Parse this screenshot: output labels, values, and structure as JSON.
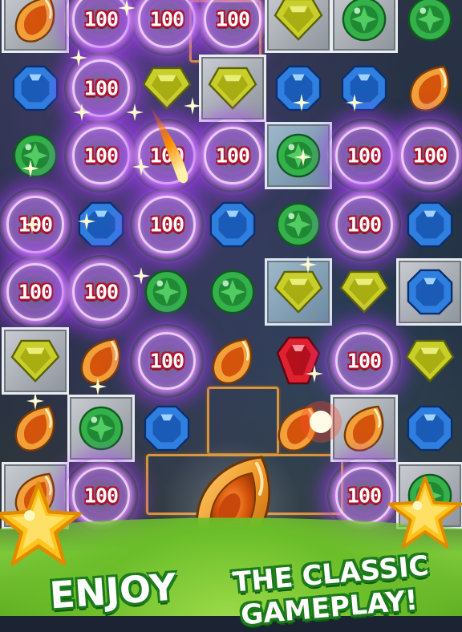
{
  "score_popup": "100",
  "banner": {
    "word1": "ENJOY",
    "word2": "THE CLASSIC",
    "word3": "GAMEPLAY!"
  },
  "board": {
    "rows": [
      [
        "amber-leaf-gem",
        "score-burst",
        "score-burst",
        "score-burst",
        "yellow-pentagon-gem",
        "green-round-gem",
        "green-round-gem"
      ],
      [
        "blue-octagon-gem",
        "score-burst",
        "yellow-pentagon-gem",
        "yellow-pentagon-gem",
        "blue-octagon-gem",
        "blue-octagon-gem",
        "amber-leaf-gem"
      ],
      [
        "green-round-gem",
        "score-burst",
        "score-burst",
        "score-burst",
        "green-round-gem",
        "score-burst",
        "score-burst"
      ],
      [
        "score-burst",
        "blue-octagon-gem",
        "score-burst",
        "blue-octagon-gem",
        "green-round-gem",
        "score-burst",
        "blue-octagon-gem"
      ],
      [
        "score-burst",
        "score-burst",
        "green-round-gem",
        "green-round-gem",
        "yellow-pentagon-gem",
        "yellow-pentagon-gem",
        "blue-octagon-gem"
      ],
      [
        "yellow-pentagon-gem",
        "amber-leaf-gem",
        "score-burst",
        "amber-leaf-gem",
        "red-ruby-gem",
        "score-burst",
        "yellow-pentagon-gem"
      ],
      [
        "amber-leaf-gem",
        "green-round-gem",
        "blue-octagon-gem",
        "empty",
        "amber-leaf-gem",
        "amber-leaf-gem",
        "blue-octagon-gem"
      ],
      [
        "amber-leaf-gem",
        "score-burst",
        "empty",
        "empty",
        "empty",
        "score-burst",
        "green-round-gem"
      ]
    ]
  },
  "colors": {
    "burst_purple": "#a640ff",
    "score_outline": "#b0132a",
    "banner_outline": "#1b7a1b",
    "grass": "#7cc83a"
  }
}
